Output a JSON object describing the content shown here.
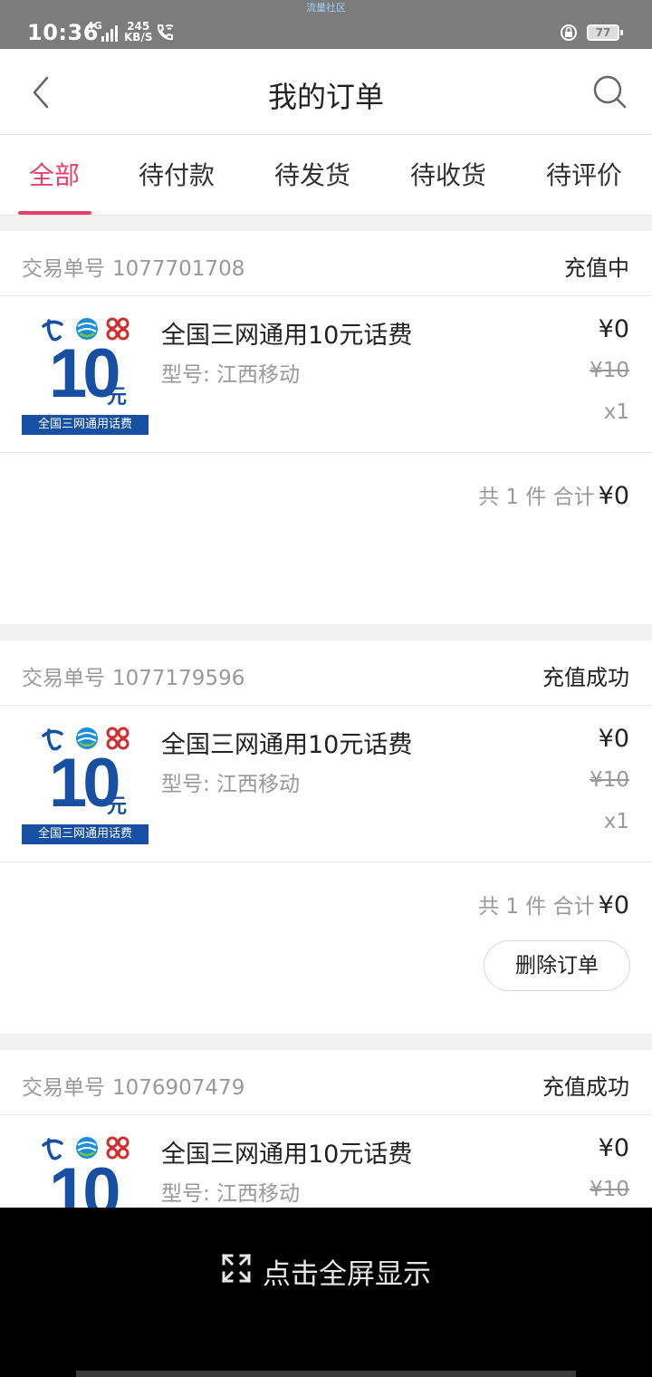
{
  "status_bar": {
    "time": "10:36",
    "network": "4G",
    "speed_value": "245",
    "speed_unit": "KB/S",
    "center_text": "流量社区",
    "battery": "77"
  },
  "header": {
    "title": "我的订单"
  },
  "tabs": [
    {
      "label": "全部",
      "active": true
    },
    {
      "label": "待付款",
      "active": false
    },
    {
      "label": "待发货",
      "active": false
    },
    {
      "label": "待收货",
      "active": false
    },
    {
      "label": "待评价",
      "active": false
    }
  ],
  "thumbnail": {
    "amount": "10",
    "unit": "元",
    "banner": "全国三网通用话费"
  },
  "order_no_label": "交易单号",
  "orders": [
    {
      "order_no": "1077701708",
      "status": "充值中",
      "product_name": "全国三网通用10元话费",
      "model": "型号: 江西移动",
      "price": "¥0",
      "original_price": "¥10",
      "quantity": "x1",
      "summary_count": "共 1 件 合计",
      "summary_total": "¥0"
    },
    {
      "order_no": "1077179596",
      "status": "充值成功",
      "product_name": "全国三网通用10元话费",
      "model": "型号: 江西移动",
      "price": "¥0",
      "original_price": "¥10",
      "quantity": "x1",
      "summary_count": "共 1 件 合计",
      "summary_total": "¥0",
      "action": "删除订单"
    },
    {
      "order_no": "1076907479",
      "status": "充值成功",
      "product_name": "全国三网通用10元话费",
      "model": "型号: 江西移动",
      "price": "¥0",
      "original_price": "¥10"
    }
  ],
  "overlay": {
    "fullscreen_text": "点击全屏显示"
  },
  "colors": {
    "accent": "#e8406a",
    "brand_blue": "#1750a3"
  }
}
